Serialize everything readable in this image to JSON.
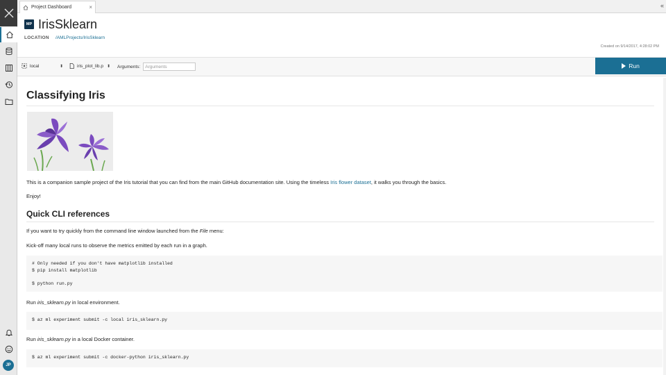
{
  "tab": {
    "label": "Project Dashboard"
  },
  "project": {
    "badge": "MP",
    "name": "IrisSklearn",
    "location_label": "LOCATION",
    "location_path": "/AMLProjects/IrisSklearn",
    "created": "Created on 9/14/2017, 4:28:02 PM"
  },
  "toolbar": {
    "target": "local",
    "script": "iris_plot_lib.p",
    "arguments_label": "Arguments:",
    "arguments_placeholder": "Arguments",
    "run_label": "Run"
  },
  "sidebar": {
    "icons": [
      "close-icon",
      "home-icon",
      "database-icon",
      "notebook-icon",
      "history-icon",
      "folder-icon",
      "bell-icon",
      "smiley-icon"
    ],
    "user_initials": "JP"
  },
  "doc": {
    "title": "Classifying Iris",
    "intro_before": "This is a companion sample project of the Iris tutorial that you can find from the main GitHub documentation site. Using the timeless ",
    "intro_link": "Iris flower dataset",
    "intro_after": ", it walks you through the basics.",
    "enjoy": "Enjoy!",
    "section_title": "Quick CLI references",
    "cli_before": "If you want to try quickly from the command line window launched from the ",
    "cli_menu": "File",
    "cli_after": " menu:",
    "kickoff": "Kick-off many local runs to observe the metrics emitted by each run in a graph.",
    "code1": "# Only needed if you don't have matplotlib installed\n$ pip install matplotlib\n\n$ python run.py",
    "run_local_pre": "Run ",
    "run_local_file": "iris_sklearn.py",
    "run_local_post": " in local environment.",
    "code2": "$ az ml experiment submit -c local iris_sklearn.py",
    "run_docker_pre": "Run ",
    "run_docker_file": "iris_sklearn.py",
    "run_docker_post": " in a local Docker container.",
    "code3": "$ az ml experiment submit -c docker-python iris_sklearn.py"
  },
  "colors": {
    "accent": "#1b6f94",
    "badge": "#11334d",
    "iris_purple": "#7b4bbf"
  }
}
